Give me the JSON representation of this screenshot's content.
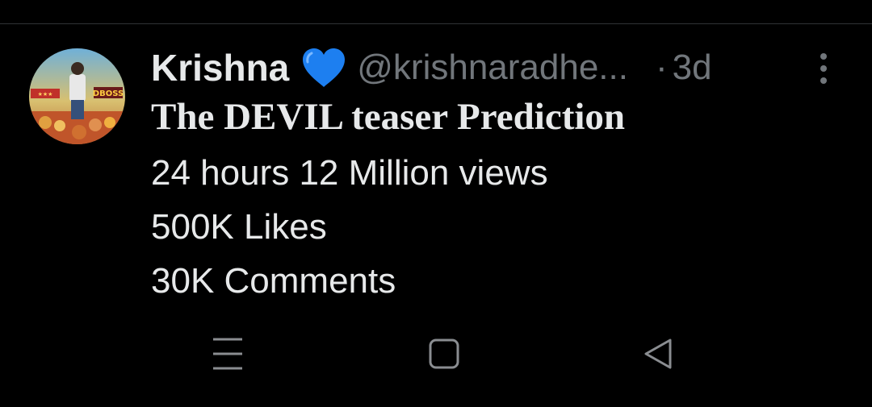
{
  "tweet": {
    "display_name": "Krishna",
    "verified_emoji": "blue-heart-icon",
    "handle": "@krishnaradhe...",
    "separator": "·",
    "timestamp": "3d",
    "title": "The DEVIL teaser Prediction",
    "lines": [
      "24 hours 12 Million views",
      "500K Likes",
      "30K Comments"
    ],
    "avatar_text": "DBOSS"
  },
  "nav_bar": {
    "icons": [
      "menu-icon",
      "home-icon",
      "back-icon"
    ]
  },
  "colors": {
    "background": "#000000",
    "text_primary": "#e7e9ea",
    "text_secondary": "#71767b",
    "heart": "#1d7ff0"
  }
}
